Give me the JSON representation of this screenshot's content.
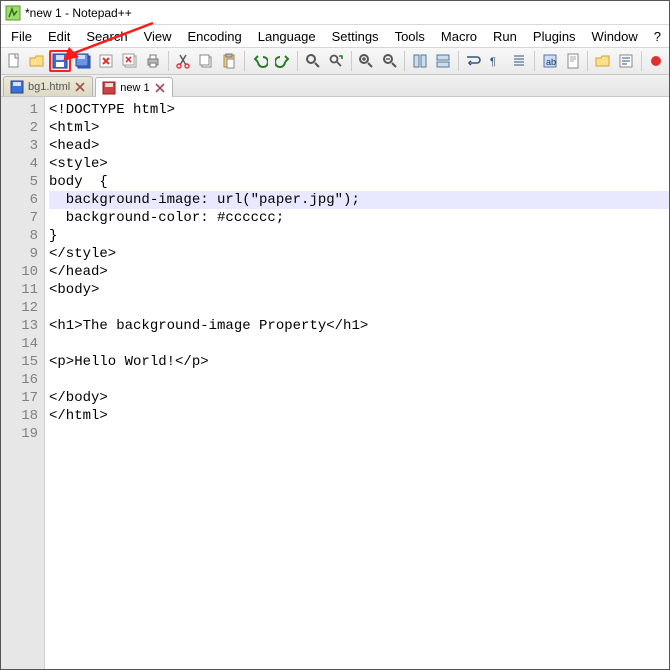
{
  "titlebar": {
    "text": "*new 1 - Notepad++"
  },
  "menu": {
    "items": [
      "File",
      "Edit",
      "Search",
      "View",
      "Encoding",
      "Language",
      "Settings",
      "Tools",
      "Macro",
      "Run",
      "Plugins",
      "Window",
      "?"
    ]
  },
  "toolbar": {
    "buttons": [
      {
        "name": "new-file-icon"
      },
      {
        "name": "open-file-icon"
      },
      {
        "name": "save-icon",
        "highlight": true
      },
      {
        "name": "save-all-icon"
      },
      {
        "name": "close-icon"
      },
      {
        "name": "close-all-icon"
      },
      {
        "name": "print-icon"
      },
      {
        "sep": true
      },
      {
        "name": "cut-icon"
      },
      {
        "name": "copy-icon"
      },
      {
        "name": "paste-icon"
      },
      {
        "sep": true
      },
      {
        "name": "undo-icon"
      },
      {
        "name": "redo-icon"
      },
      {
        "sep": true
      },
      {
        "name": "find-icon"
      },
      {
        "name": "replace-icon"
      },
      {
        "sep": true
      },
      {
        "name": "zoom-in-icon"
      },
      {
        "name": "zoom-out-icon"
      },
      {
        "sep": true
      },
      {
        "name": "sync-v-icon"
      },
      {
        "name": "sync-h-icon"
      },
      {
        "sep": true
      },
      {
        "name": "wordwrap-icon"
      },
      {
        "name": "all-chars-icon"
      },
      {
        "name": "indent-guide-icon"
      },
      {
        "sep": true
      },
      {
        "name": "lang-icon"
      },
      {
        "name": "doc-map-icon"
      },
      {
        "sep": true
      },
      {
        "name": "folder-icon"
      },
      {
        "name": "function-list-icon"
      },
      {
        "sep": true
      },
      {
        "name": "record-icon"
      }
    ]
  },
  "tabs": [
    {
      "label": "bg1.html",
      "active": false,
      "saved": true
    },
    {
      "label": "new 1",
      "active": true,
      "saved": false
    }
  ],
  "editor": {
    "highlighted_line": 6,
    "lines": [
      "<!DOCTYPE html>",
      "<html>",
      "<head>",
      "<style>",
      "body  {",
      "  background-image: url(\"paper.jpg\");",
      "  background-color: #cccccc;",
      "}",
      "</style>",
      "</head>",
      "<body>",
      "",
      "<h1>The background-image Property</h1>",
      "",
      "<p>Hello World!</p>",
      "",
      "</body>",
      "</html>",
      ""
    ]
  },
  "annotation": {
    "arrow_to": "save-icon"
  }
}
